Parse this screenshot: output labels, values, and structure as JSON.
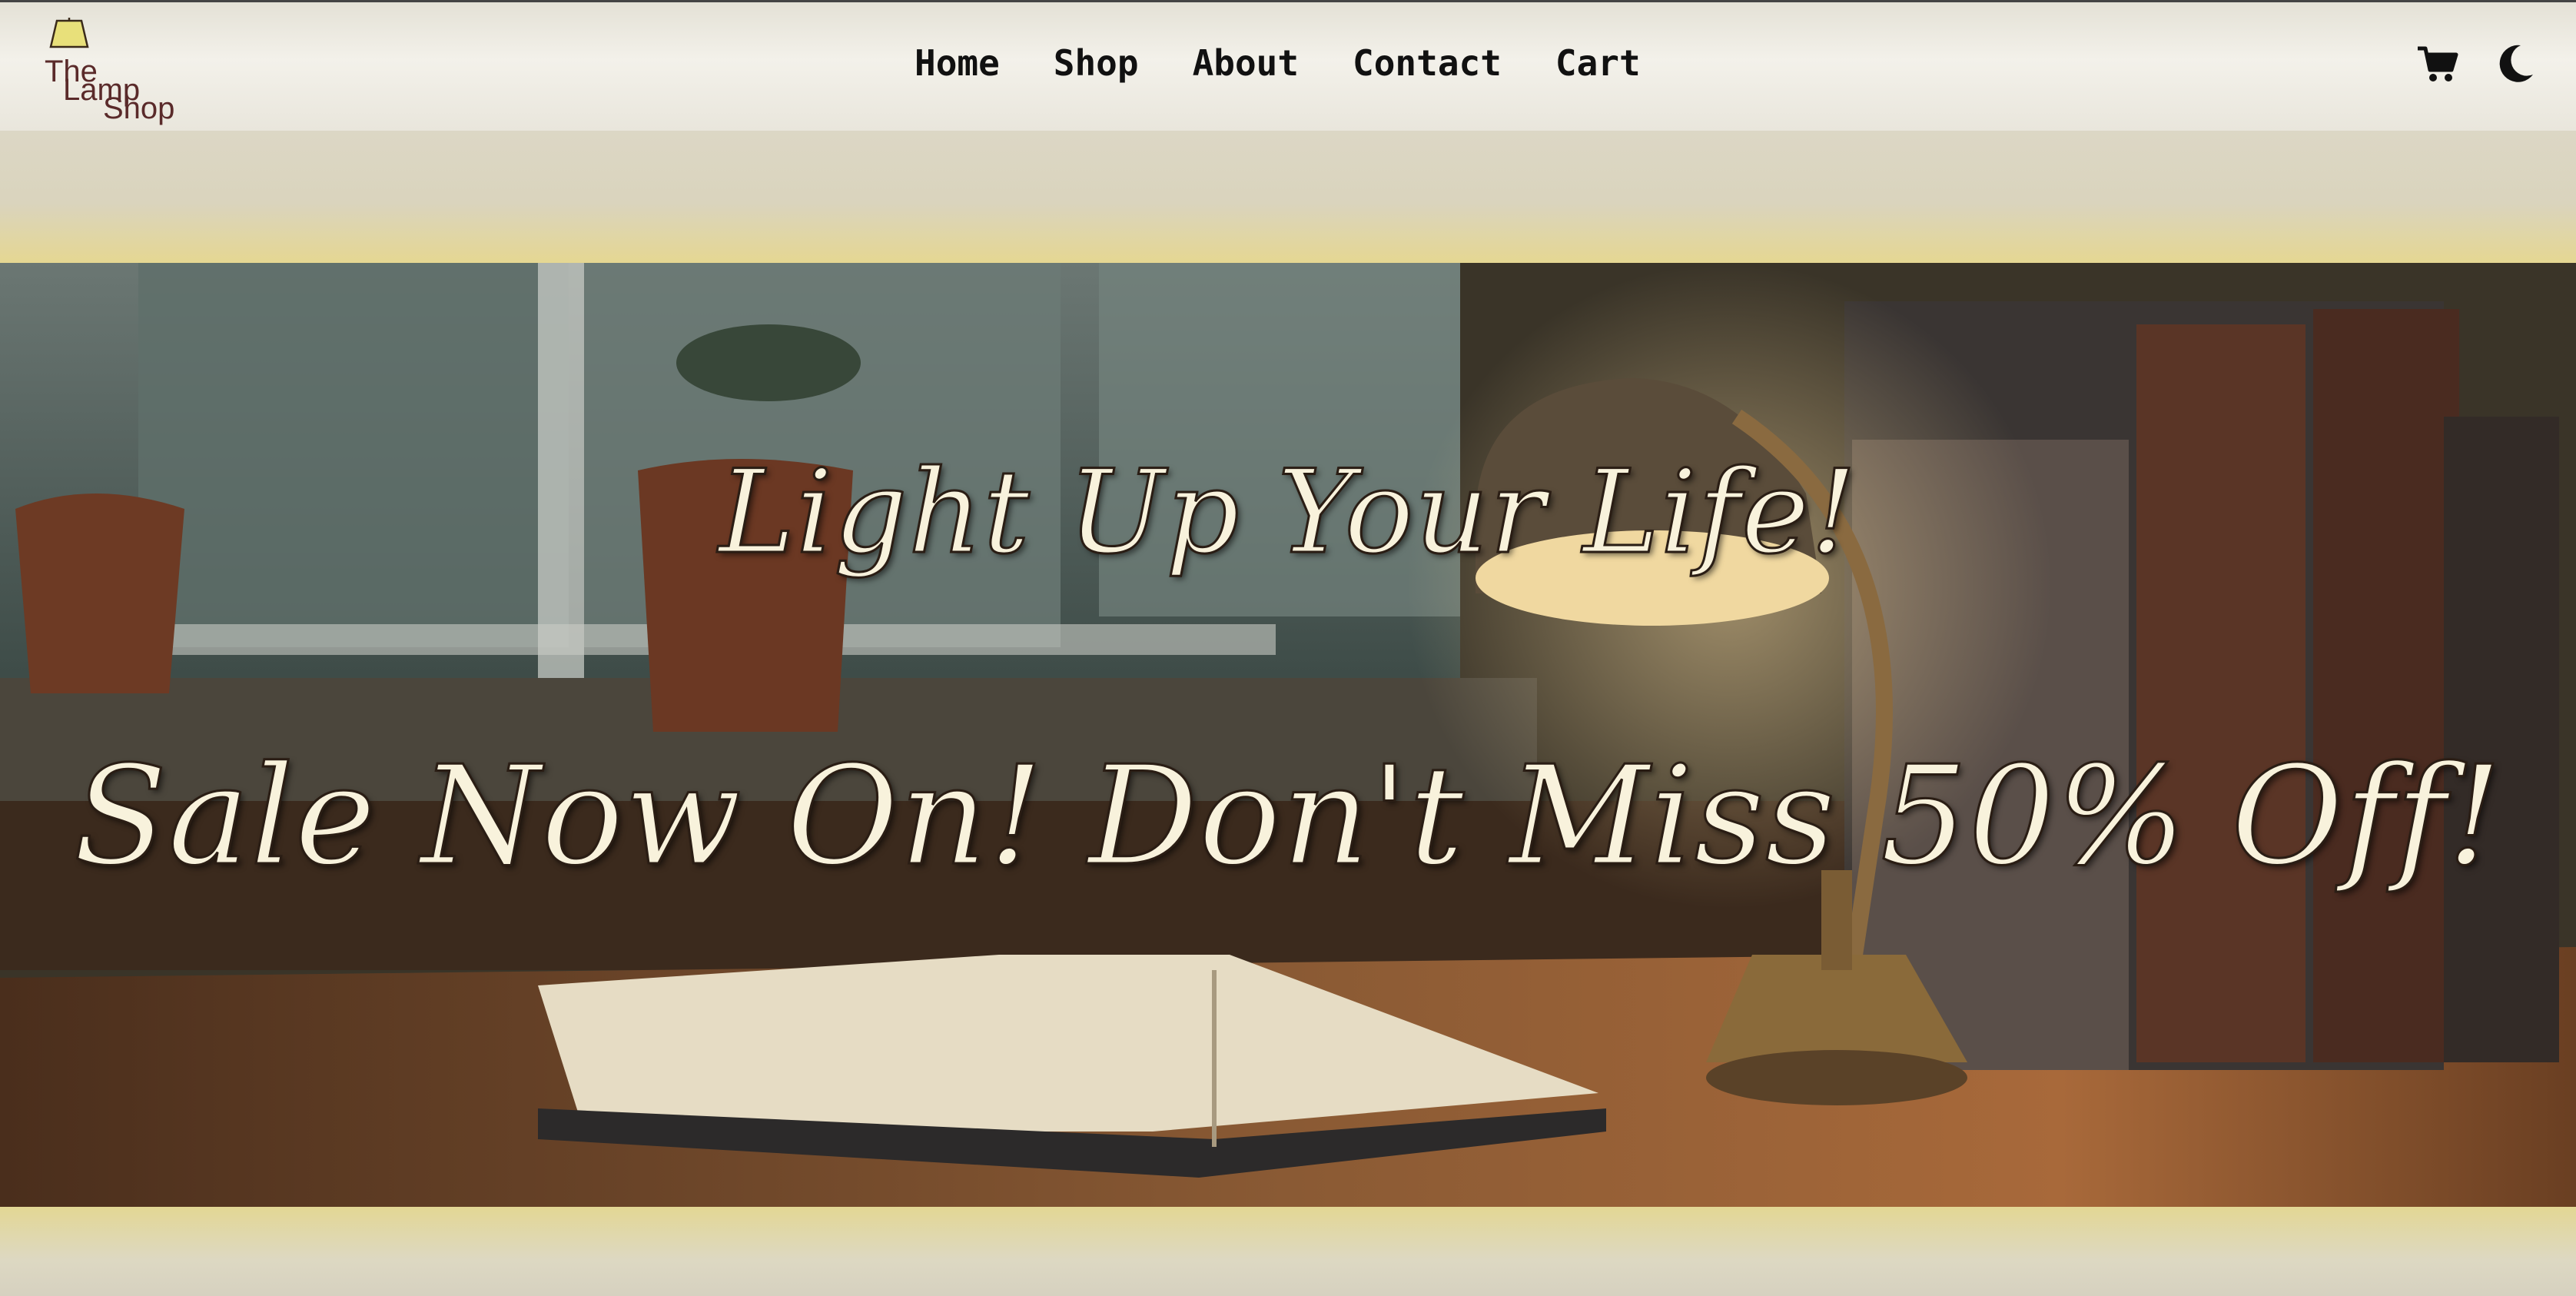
{
  "logo": {
    "line1": "The",
    "line2": "Lamp",
    "line3": "Shop",
    "icon": "lamp-icon"
  },
  "nav": {
    "links": [
      "Home",
      "Shop",
      "About",
      "Contact",
      "Cart"
    ]
  },
  "actions": {
    "cart_icon": "cart-icon",
    "theme_icon": "moon-icon"
  },
  "hero": {
    "headline": "Light Up Your Life!",
    "subheadline": "Sale Now On! Don't Miss 50% Off!"
  },
  "colors": {
    "nav_bg": "#f1efe7",
    "band": "#ddd8c6",
    "band_accent": "#e5d792",
    "headline_fill": "#f8f2dc",
    "nav_text": "#111111"
  }
}
